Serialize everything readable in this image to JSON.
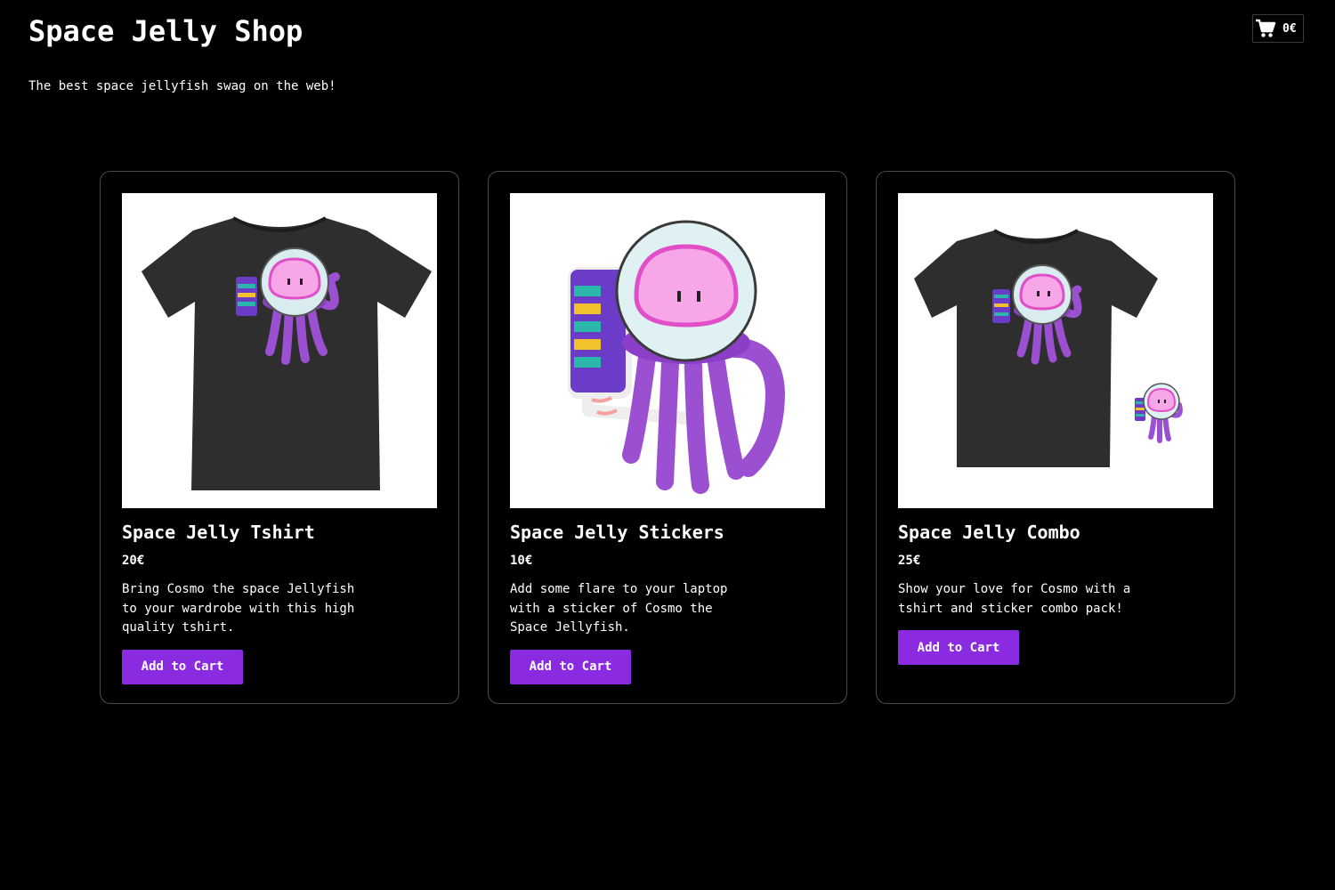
{
  "header": {
    "title": "Space Jelly Shop",
    "tagline": "The best space jellyfish swag on the web!"
  },
  "cart": {
    "icon": "shopping-cart-icon",
    "total": "0€"
  },
  "products": [
    {
      "image": "space-jelly-tshirt-image",
      "name": "Space Jelly Tshirt",
      "price": "20€",
      "description": "Bring Cosmo the space Jellyfish to your wardrobe with this high quality tshirt.",
      "button_label": "Add to Cart"
    },
    {
      "image": "space-jelly-sticker-image",
      "name": "Space Jelly Stickers",
      "price": "10€",
      "description": "Add some flare to your laptop with a sticker of Cosmo the Space Jellyfish.",
      "button_label": "Add to Cart"
    },
    {
      "image": "space-jelly-combo-image",
      "name": "Space Jelly Combo",
      "price": "25€",
      "description": "Show your love for Cosmo with a tshirt and sticker combo pack!",
      "button_label": "Add to Cart"
    }
  ],
  "colors": {
    "background": "#000000",
    "button": "#8a2be2",
    "card_border": "#4a4a4a",
    "jelly_purple": "#9b4fd1",
    "jelly_pink": "#f7a6e8",
    "shirt": "#2e2e2e"
  }
}
